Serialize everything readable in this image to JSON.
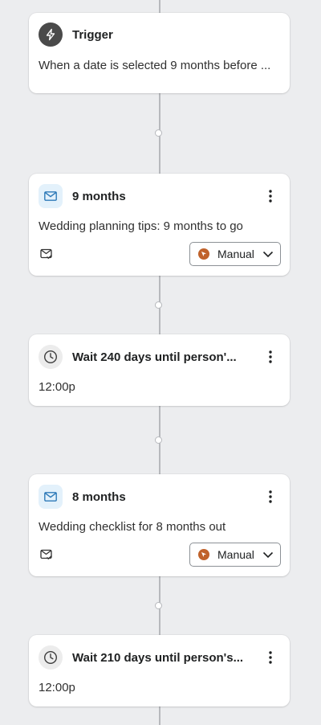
{
  "flow": {
    "trigger": {
      "icon": "lightning-icon",
      "title": "Trigger",
      "description": "When a date is selected 9 months before ..."
    },
    "steps": [
      {
        "type": "email",
        "icon": "mail-icon",
        "title": "9 months",
        "description": "Wedding planning tips: 9 months to go",
        "status_icon": "email-check-icon",
        "mode": "Manual"
      },
      {
        "type": "wait",
        "icon": "clock-icon",
        "title": "Wait 240 days until person'...",
        "description": "12:00p"
      },
      {
        "type": "email",
        "icon": "mail-icon",
        "title": "8 months",
        "description": "Wedding checklist for 8 months out",
        "status_icon": "email-check-icon",
        "mode": "Manual"
      },
      {
        "type": "wait",
        "icon": "clock-icon",
        "title": "Wait 210 days until person's...",
        "description": "12:00p"
      }
    ]
  },
  "colors": {
    "canvas": "#ecedef",
    "connector": "#b7b9bd",
    "email_badge": "#e3f1fb",
    "email_icon": "#2e7ab8",
    "manual_badge": "#c0622b",
    "trigger_badge": "#4a4a4a"
  }
}
